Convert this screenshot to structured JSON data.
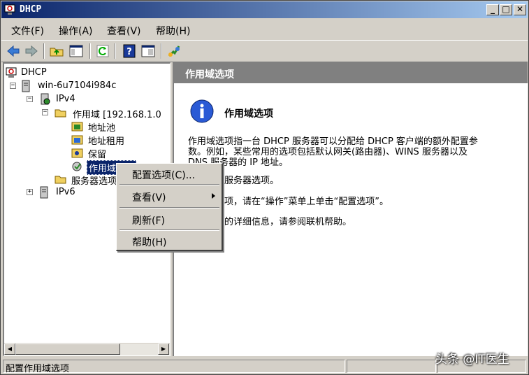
{
  "window": {
    "title": "DHCP"
  },
  "title_buttons": {
    "minimize": "_",
    "maximize": "□",
    "close": "✕"
  },
  "menubar": {
    "items": [
      "文件(F)",
      "操作(A)",
      "查看(V)",
      "帮助(H)"
    ]
  },
  "toolbar": {
    "buttons": [
      "back-arrow-icon",
      "forward-arrow-icon",
      "up-folder-icon",
      "show-tree-icon",
      "refresh-icon",
      "help-icon",
      "console-icon",
      "add-options-icon"
    ]
  },
  "tree": {
    "root": "DHCP",
    "server": "win-6u7104i984c",
    "ipv4": "IPv4",
    "scope": "作用域 [192.168.1.0",
    "address_pool": "地址池",
    "address_leases": "地址租用",
    "reservations": "保留",
    "scope_options": "作用域选项",
    "server_options": "服务器选项",
    "ipv6": "IPv6"
  },
  "right": {
    "header": "作用域选项",
    "title": "作用域选项",
    "para1_line1": "作用域选项指一台 DHCP 服务器可以分配给 DHCP 客户端的额外配置参",
    "para1_line2": "数。例如，某些常用的选项包括默认网关(路由器)、WINS 服务器以及",
    "para1_line3": "DNS 服务器的 IP 地址。",
    "para2": "选项替代服务器选项。",
    "para3": "作用域选项，请在“操作”菜单上单击“配置选项”。",
    "para4": "务器选项的详细信息，请参阅联机帮助。"
  },
  "context_menu": {
    "configure": "配置选项(C)...",
    "view": "查看(V)",
    "refresh": "刷新(F)",
    "help": "帮助(H)"
  },
  "status": {
    "text": "配置作用域选项"
  },
  "watermark": "头条 @IT医生",
  "colors": {
    "title_active": "#0a246a",
    "title_gradient_end": "#a6caf0",
    "header_gray": "#808080",
    "face": "#d4d0c8"
  }
}
